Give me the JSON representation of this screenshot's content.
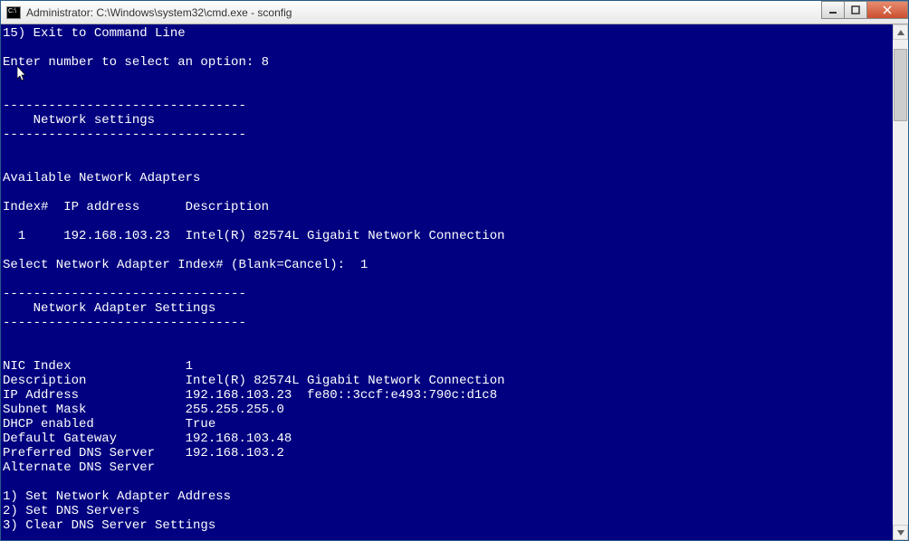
{
  "titlebar": {
    "text": "Administrator: C:\\Windows\\system32\\cmd.exe - sconfig"
  },
  "terminal": {
    "line01": "15) Exit to Command Line",
    "line02": "",
    "line03": "Enter number to select an option: 8",
    "line04": "",
    "line05": "",
    "line06": "--------------------------------",
    "line07": "    Network settings",
    "line08": "--------------------------------",
    "line09": "",
    "line10": "",
    "line11": "Available Network Adapters",
    "line12": "",
    "line13": "Index#  IP address      Description",
    "line14": "",
    "line15": "  1     192.168.103.23  Intel(R) 82574L Gigabit Network Connection",
    "line16": "",
    "line17": "Select Network Adapter Index# (Blank=Cancel):  1",
    "line18": "",
    "line19": "--------------------------------",
    "line20": "    Network Adapter Settings",
    "line21": "--------------------------------",
    "line22": "",
    "line23": "",
    "line24": "NIC Index               1",
    "line25": "Description             Intel(R) 82574L Gigabit Network Connection",
    "line26": "IP Address              192.168.103.23  fe80::3ccf:e493:790c:d1c8",
    "line27": "Subnet Mask             255.255.255.0",
    "line28": "DHCP enabled            True",
    "line29": "Default Gateway         192.168.103.48",
    "line30": "Preferred DNS Server    192.168.103.2",
    "line31": "Alternate DNS Server",
    "line32": "",
    "line33": "1) Set Network Adapter Address",
    "line34": "2) Set DNS Servers",
    "line35": "3) Clear DNS Server Settings"
  }
}
